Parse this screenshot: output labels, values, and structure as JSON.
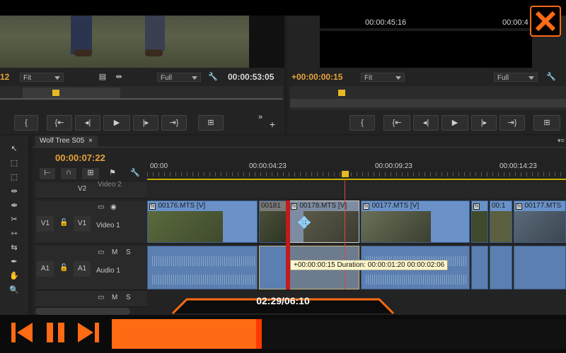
{
  "source_monitor": {
    "timecode_left": "12",
    "fit_label": "Fit",
    "full_label": "Full",
    "timecode": "00:00:53:05"
  },
  "program_monitor": {
    "frame_timecode_a": "00:00:45:16",
    "frame_timecode_b": "00:00:4",
    "timecode": "+00:00:00:15",
    "fit_label": "Fit",
    "full_label": "Full"
  },
  "sequence": {
    "tab_name": "Wolf Tree S05",
    "tab_close": "×",
    "playhead_timecode": "00:00:07:22",
    "ruler": [
      "00:00",
      "00:00:04:23",
      "00:00:09:23",
      "00:00:14:23"
    ]
  },
  "tracks": {
    "v2": {
      "name": "V2",
      "label": "Video 2"
    },
    "v1": {
      "name": "V1",
      "src": "V1",
      "label": "Video 1",
      "lock": "🔒",
      "m": "",
      "s": ""
    },
    "a1": {
      "name": "A1",
      "src": "A1",
      "label": "Audio 1",
      "m": "M",
      "s": "S"
    },
    "a_extra": {
      "m": "M",
      "s": "S"
    }
  },
  "clips": {
    "c176": "00176.MTS [V]",
    "c181": "00181",
    "c178": "00178.MTS [V]",
    "c177": "00177.MTS [V]",
    "c17": "00:1",
    "c177b": "00177.MTS",
    "fx": "fx"
  },
  "tooltip": "+00:00:00:15 Duration: 00:00:01:20 00:00:02:06",
  "player": {
    "time": "02:29/06:10",
    "progress": 0.33
  },
  "colors": {
    "accent": "#ff6a14",
    "timecode": "#e8a33a",
    "clip_video": "#6a92c9",
    "clip_audio": "#5a7fb0"
  }
}
